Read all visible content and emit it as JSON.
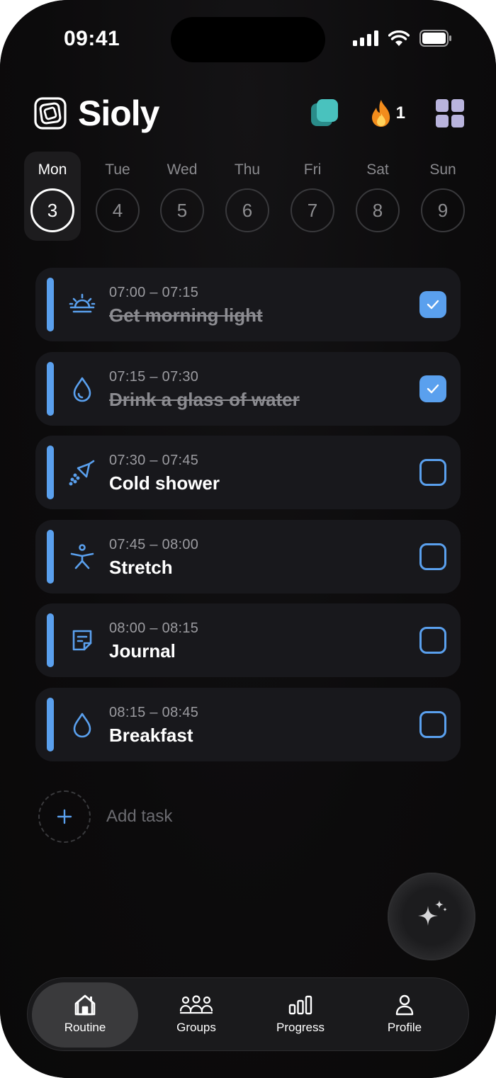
{
  "status_bar": {
    "time": "09:41"
  },
  "header": {
    "title": "Sioly",
    "streak_count": "1"
  },
  "week": [
    {
      "label": "Mon",
      "date": "3",
      "active": true
    },
    {
      "label": "Tue",
      "date": "4"
    },
    {
      "label": "Wed",
      "date": "5"
    },
    {
      "label": "Thu",
      "date": "6"
    },
    {
      "label": "Fri",
      "date": "7"
    },
    {
      "label": "Sat",
      "date": "8"
    },
    {
      "label": "Sun",
      "date": "9"
    }
  ],
  "tasks": [
    {
      "time": "07:00 – 07:15",
      "title": "Get morning light",
      "icon": "sunrise-icon",
      "done": true
    },
    {
      "time": "07:15 – 07:30",
      "title": "Drink a glass of water",
      "icon": "water-drop-icon",
      "done": true
    },
    {
      "time": "07:30 – 07:45",
      "title": "Cold shower",
      "icon": "shower-icon",
      "done": false
    },
    {
      "time": "07:45 – 08:00",
      "title": "Stretch",
      "icon": "stretch-icon",
      "done": false
    },
    {
      "time": "08:00 – 08:15",
      "title": "Journal",
      "icon": "note-icon",
      "done": false
    },
    {
      "time": "08:15 – 08:45",
      "title": "Breakfast",
      "icon": "water-drop-icon",
      "done": false
    }
  ],
  "add_task": {
    "label": "Add task"
  },
  "nav": [
    {
      "label": "Routine",
      "icon": "home-icon",
      "active": true
    },
    {
      "label": "Groups",
      "icon": "groups-icon"
    },
    {
      "label": "Progress",
      "icon": "bar-chart-icon"
    },
    {
      "label": "Profile",
      "icon": "person-icon"
    }
  ],
  "colors": {
    "accent": "#5aa0ee",
    "card": "#18181c",
    "background": "#0d0c0d"
  }
}
